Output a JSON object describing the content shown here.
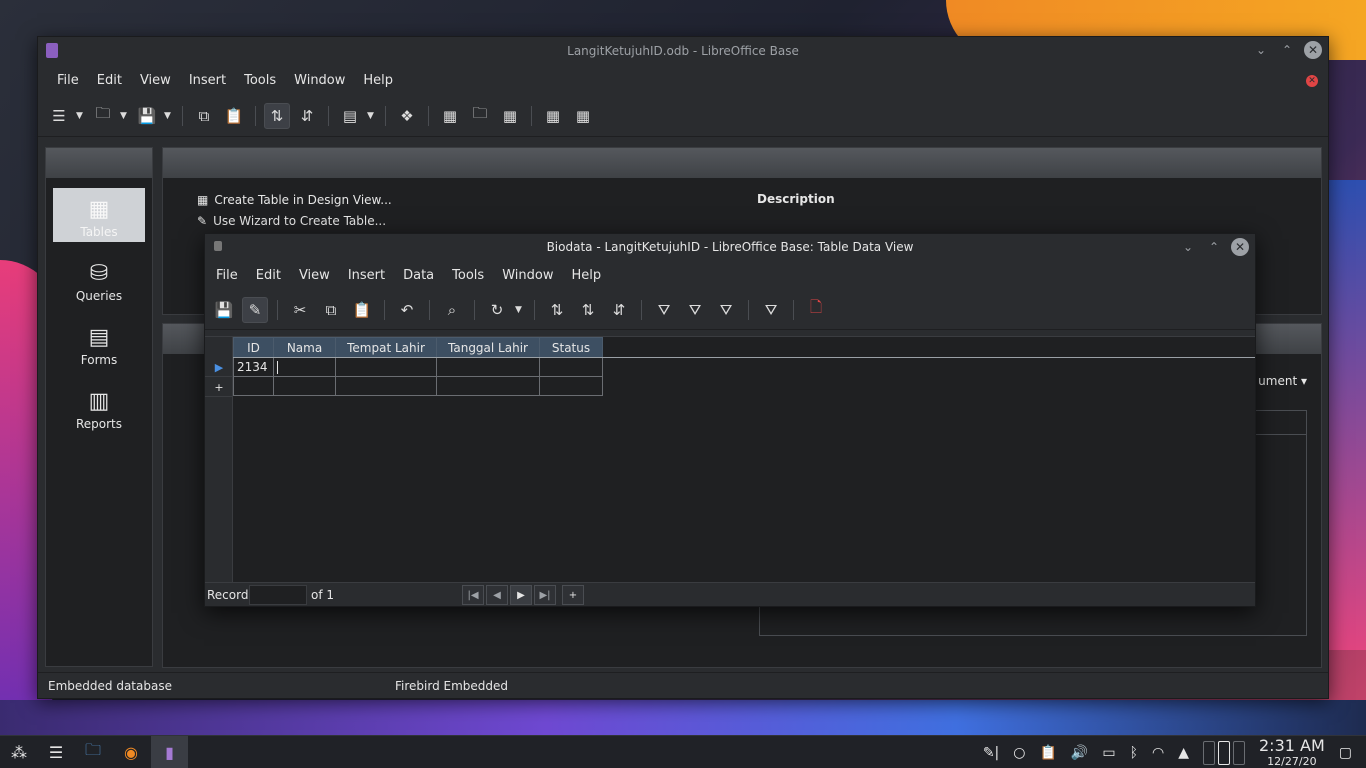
{
  "main": {
    "title": "LangitKetujuhID.odb - LibreOffice Base",
    "menu": [
      "File",
      "Edit",
      "View",
      "Insert",
      "Tools",
      "Window",
      "Help"
    ],
    "sidebar": [
      {
        "label": "Tables",
        "icon": "table-icon"
      },
      {
        "label": "Queries",
        "icon": "database-icon"
      },
      {
        "label": "Forms",
        "icon": "form-icon"
      },
      {
        "label": "Reports",
        "icon": "report-icon"
      }
    ],
    "tasks": [
      "Create Table in Design View...",
      "Use Wizard to Create Table..."
    ],
    "description_label": "Description",
    "doc_dropdown": "ument",
    "status": {
      "left": "Embedded database",
      "right": "Firebird Embedded"
    }
  },
  "data_window": {
    "title": "Biodata - LangitKetujuhID - LibreOffice Base: Table Data View",
    "menu": [
      "File",
      "Edit",
      "View",
      "Insert",
      "Data",
      "Tools",
      "Window",
      "Help"
    ],
    "columns": [
      "ID",
      "Nama",
      "Tempat Lahir",
      "Tanggal Lahir",
      "Status"
    ],
    "rows": [
      [
        "2134",
        "",
        "",
        "",
        ""
      ]
    ],
    "new_row_marker": "+",
    "nav": {
      "record_label": "Record",
      "of_label": "of 1",
      "add": "+"
    }
  },
  "taskbar": {
    "time": "2:31 AM",
    "date": "12/27/20"
  }
}
